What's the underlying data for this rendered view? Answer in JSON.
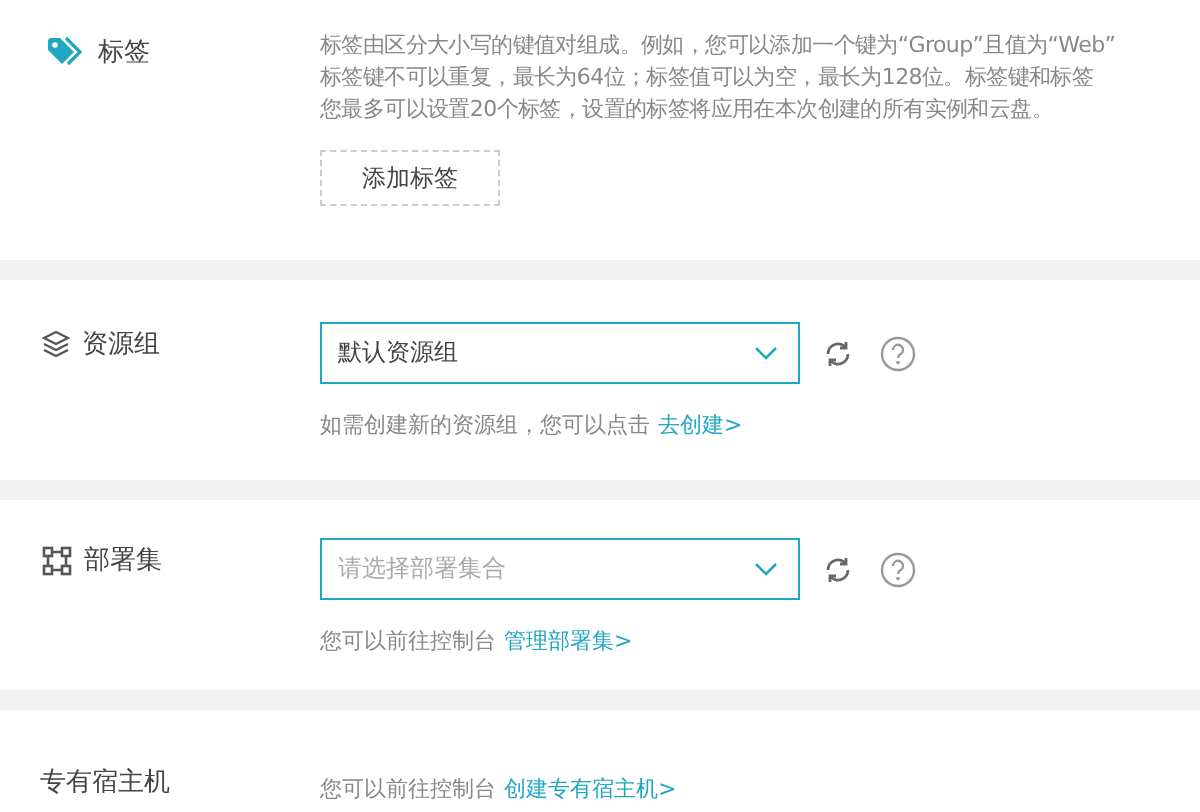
{
  "sections": [
    {
      "kind": "tags",
      "label": "标签",
      "description": [
        "标签由区分大小写的键值对组成。例如，您可以添加一个键为“Group”且值为“Web”",
        "标签键不可以重复，最长为64位；标签值可以为空，最长为128位。标签键和标签",
        "您最多可以设置20个标签，设置的标签将应用在本次创建的所有实例和云盘。"
      ],
      "button": "添加标签"
    },
    {
      "kind": "resource-group",
      "label": "资源组",
      "select": {
        "value": "默认资源组"
      },
      "hint": "如需创建新的资源组，您可以点击",
      "link": "去创建>"
    },
    {
      "kind": "deployment-set",
      "label": "部署集",
      "select": {
        "placeholder": "请选择部署集合"
      },
      "hint": "您可以前往控制台",
      "link": "管理部署集>"
    },
    {
      "kind": "dedicated-host",
      "label": "专有宿主机",
      "hint": "您可以前往控制台",
      "link": "创建专有宿主机>"
    }
  ]
}
